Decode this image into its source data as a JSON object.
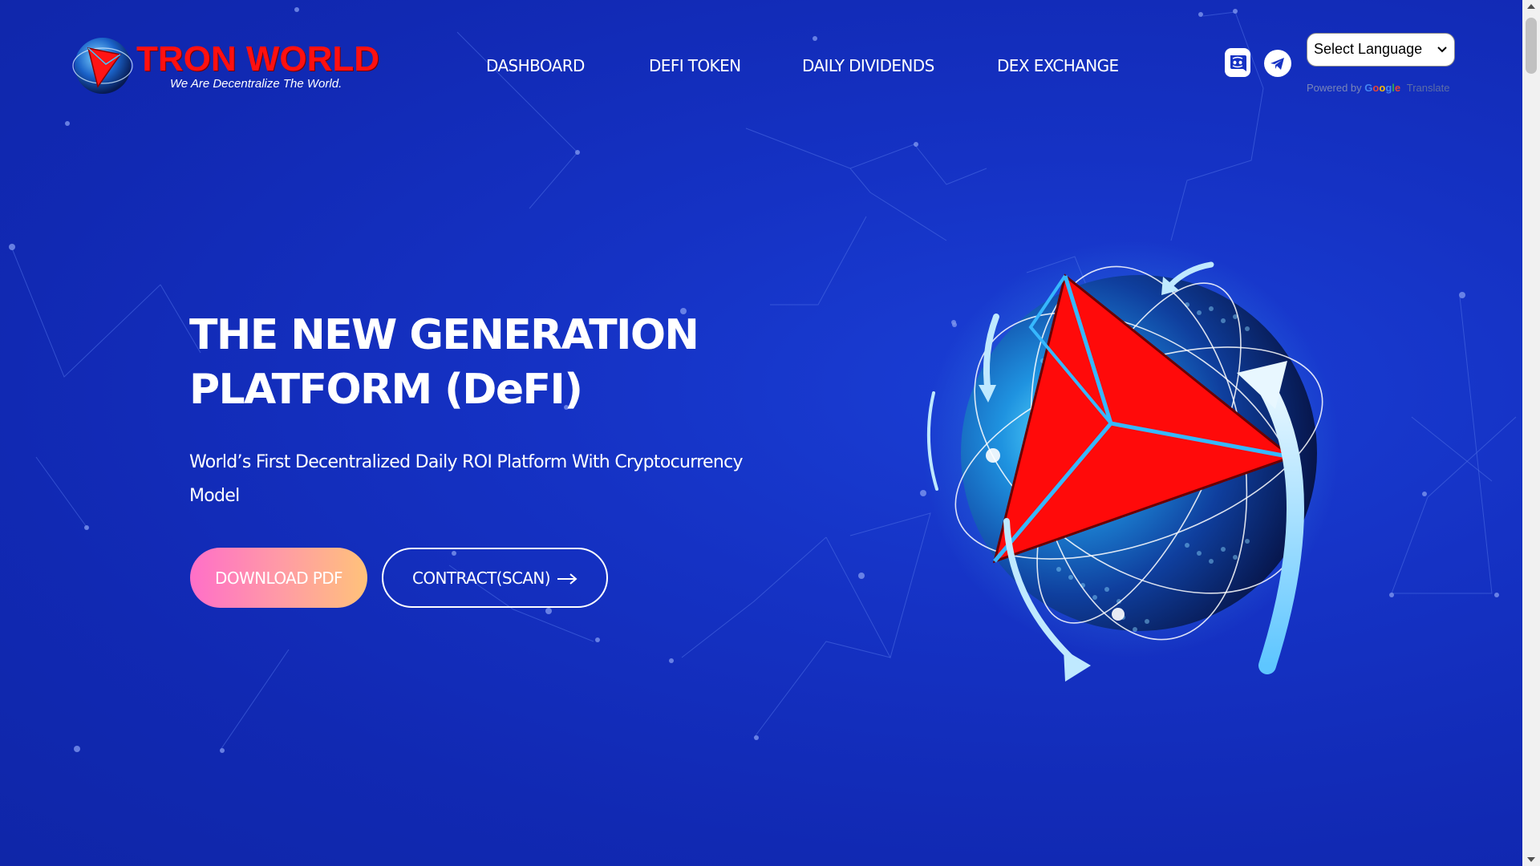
{
  "brand": {
    "name": "TRON WORLD",
    "tagline": "We Are Decentralize The World."
  },
  "nav": {
    "items": [
      {
        "label": "DASHBOARD"
      },
      {
        "label": "DEFI TOKEN"
      },
      {
        "label": "DAILY DIVIDENDS"
      },
      {
        "label": "DEX EXCHANGE"
      }
    ]
  },
  "social": {
    "discord_icon": "discord-icon",
    "telegram_icon": "telegram-icon"
  },
  "translate": {
    "select_value": "Select Language",
    "powered_prefix": "Powered by",
    "google_g": "G",
    "google_o1": "o",
    "google_o2": "o",
    "google_g2": "g",
    "google_l": "l",
    "google_e": "e",
    "translate_label": "Translate"
  },
  "hero": {
    "title_line1": "THE NEW GENERATION",
    "title_line2": "PLATFORM (DeFI)",
    "subtitle": "World’s First Decentralized Daily ROI Platform With Cryptocurrency Model",
    "download_label": "DOWNLOAD PDF",
    "contract_label": "CONTRACT(SCAN)",
    "arrow_icon": "arrow-right-icon"
  },
  "colors": {
    "background": "#1532c4",
    "brand_red": "#ff1010",
    "download_gradient_start": "#ff6fc8",
    "download_gradient_end": "#ffc27a"
  }
}
